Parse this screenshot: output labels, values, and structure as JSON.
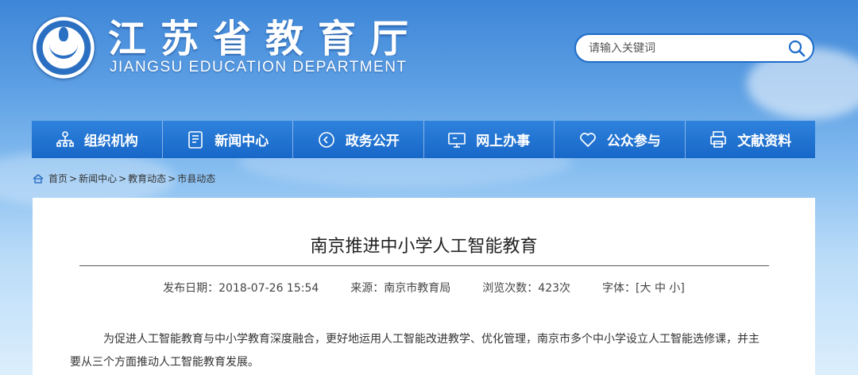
{
  "header": {
    "logo_title": "江苏省教育厅",
    "logo_subtitle": "JIANGSU EDUCATION DEPARTMENT"
  },
  "search": {
    "placeholder": "请输入关键词"
  },
  "nav": {
    "items": [
      {
        "label": "组织机构",
        "icon": "org-chart-icon"
      },
      {
        "label": "新闻中心",
        "icon": "document-icon"
      },
      {
        "label": "政务公开",
        "icon": "circle-arrow-icon"
      },
      {
        "label": "网上办事",
        "icon": "monitor-icon"
      },
      {
        "label": "公众参与",
        "icon": "heart-icon"
      },
      {
        "label": "文献资料",
        "icon": "printer-icon"
      }
    ]
  },
  "breadcrumb": {
    "home": "首页",
    "items": [
      "新闻中心",
      "教育动态",
      "市县动态"
    ]
  },
  "article": {
    "title": "南京推进中小学人工智能教育",
    "date_label": "发布日期：2018-07-26 15:54",
    "source_label": "来源：南京市教育局",
    "views_label": "浏览次数：423次",
    "font_label": "字体：[",
    "font_large": "大",
    "font_medium": "中",
    "font_small": "小",
    "font_close": "]",
    "paragraph": "为促进人工智能教育与中小学教育深度融合，更好地运用人工智能改进教学、优化管理，南京市多个中小学设立人工智能选修课，并主要从三个方面推动人工智能教育发展。"
  },
  "colors": {
    "nav_bg": "#1767c8",
    "search_border": "#1d6cc9"
  }
}
